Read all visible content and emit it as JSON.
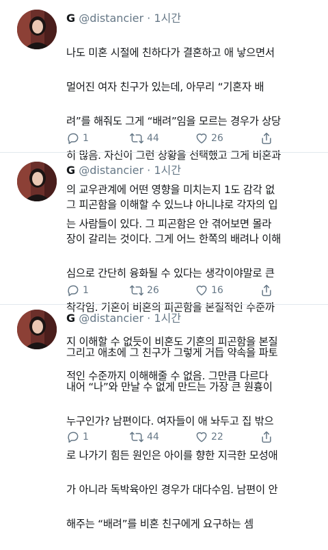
{
  "tweets": [
    {
      "name": "G",
      "handle": "@distancier",
      "sep": "·",
      "time": "1시간",
      "lines": [
        "나도 미혼 시절에 친하다가 결혼하고 애 낳으면서",
        "멀어진 여자 친구가 있는데, 아무리 “기혼자 배",
        "려”를 해줘도 그게 “배려”임을 모르는 경우가 상당",
        "히 많음. 자신이 그런 상황을 선택했고 그게 비혼과",
        "의 교우관계에 어떤 영향을 미치는지 1도 감각 없",
        "는 사람들이 있다. 그 피곤함은 안 겪어보면 몰라"
      ],
      "reply_count": "1",
      "retweet_count": "44",
      "like_count": "26"
    },
    {
      "name": "G",
      "handle": "@distancier",
      "sep": "·",
      "time": "1시간",
      "lines": [
        "그 피곤함을 이해할 수 있느냐 아니냐로 각자의 입",
        "장이 갈리는 것이다. 그게 어느 한쪽의 배려나 이해",
        "심으로 간단히 융화될 수 있다는 생각이야말로 큰",
        "착각임. 기혼이 비혼의 피곤함을 본질적인 수준까",
        "지 이해할 수 없듯이 비혼도 기혼의 피곤함을 본질",
        "적인 수준까지 이해해줄 수 없음. 그만큼 다르다"
      ],
      "reply_count": "1",
      "retweet_count": "26",
      "like_count": "16"
    },
    {
      "name": "G",
      "handle": "@distancier",
      "sep": "·",
      "time": "1시간",
      "lines": [
        "그리고 애초에 그 친구가 그렇게 거듭 약속을 파토",
        "내어 “나”와 만날 수 없게 만드는 가장 큰 원흉이",
        "누구인가? 남편이다. 여자들이 애 놔두고 집 밖으",
        "로 나가기 힘든 원인은 아이를 향한 지극한 모성애",
        "가 아니라 독박육아인 경우가 대다수임. 남편이 안",
        "해주는 “배려”를 비혼 친구에게 요구하는 셈"
      ],
      "reply_count": "1",
      "retweet_count": "44",
      "like_count": "22"
    }
  ],
  "icons": {
    "reply": "reply-icon",
    "retweet": "retweet-icon",
    "like": "heart-icon",
    "share": "share-icon"
  },
  "colors": {
    "text": "#14171a",
    "secondary": "#657786",
    "divider": "#e1e8ed"
  }
}
